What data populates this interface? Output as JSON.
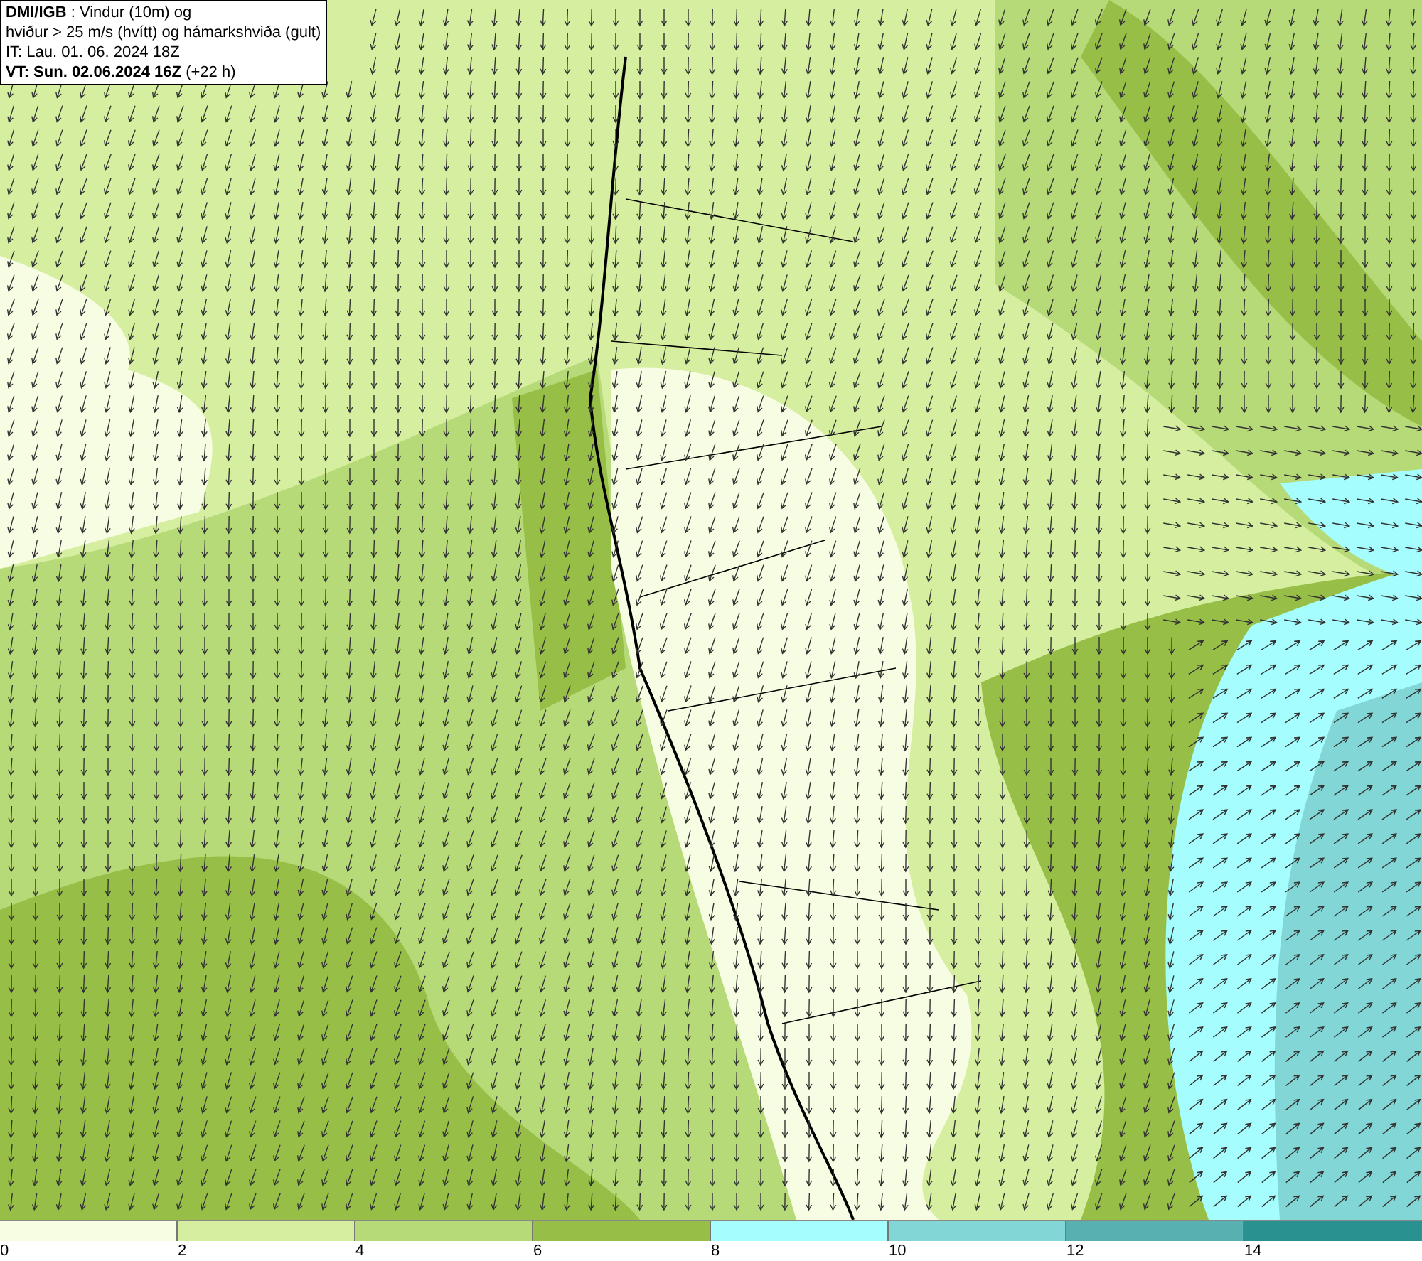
{
  "header": {
    "lines": [
      "**DMI/IGB** : Vindur (10m) og",
      "hviður > 25 m/s (hvítt) og hámarkshviða (gult)",
      "IT: Lau. 01. 06. 2024 18Z",
      "**VT: Sun. 02.06.2024 16Z** (+22 h)"
    ]
  },
  "legend": {
    "bins": [
      {
        "color": "#f7fde3"
      },
      {
        "color": "#d5ee9f"
      },
      {
        "color": "#b6da78"
      },
      {
        "color": "#97bf48"
      },
      {
        "color": "#a6fdfd"
      },
      {
        "color": "#82d6d6"
      },
      {
        "color": "#58b0b0"
      },
      {
        "color": "#2a9191"
      }
    ],
    "ticks": [
      "0",
      "2",
      "4",
      "6",
      "8",
      "10",
      "12",
      "14"
    ]
  }
}
